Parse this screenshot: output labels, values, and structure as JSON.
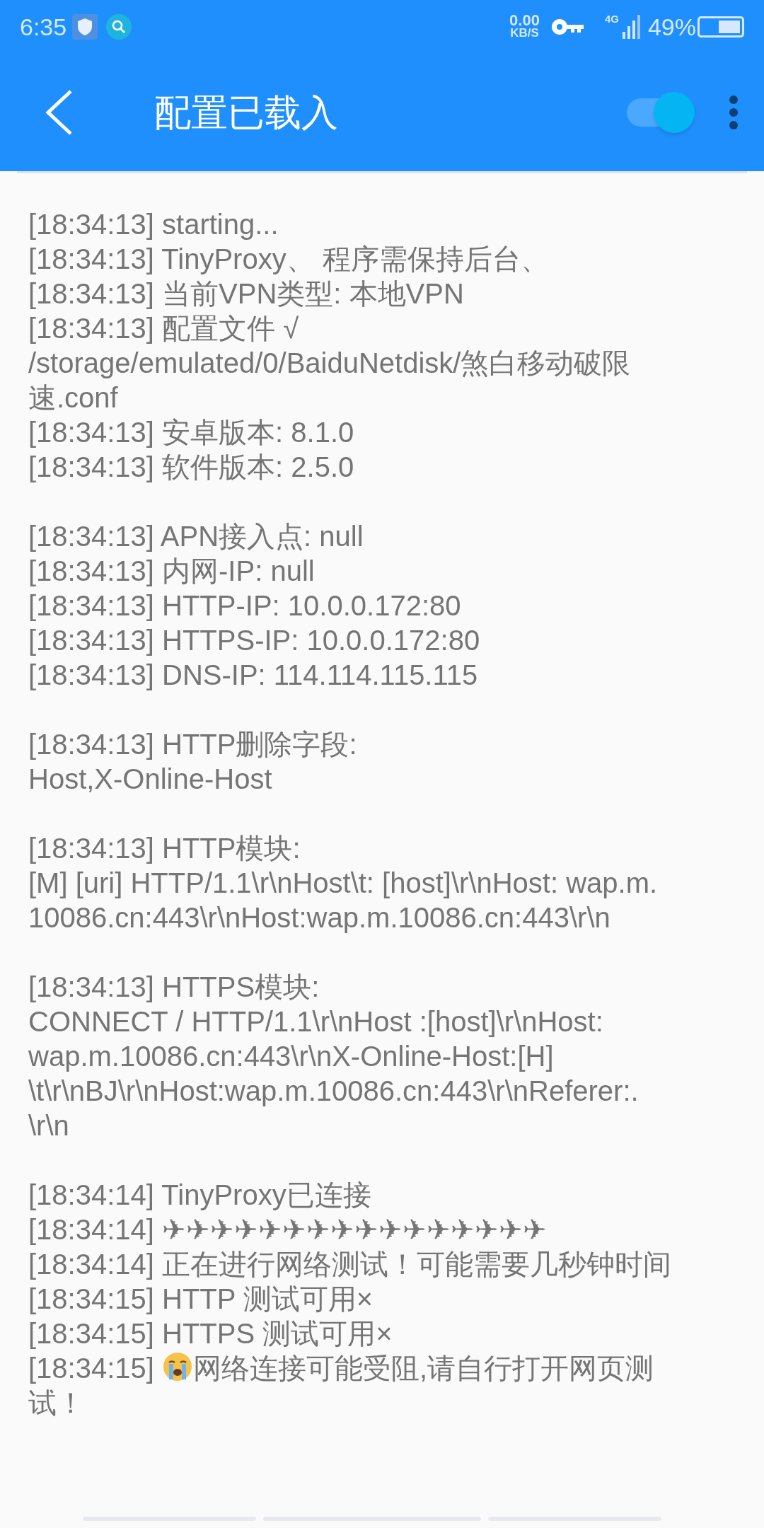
{
  "status_bar": {
    "time": "6:35",
    "net_speed": "0.00",
    "net_unit": "KB/S",
    "network": "4G",
    "battery": "49%"
  },
  "app_bar": {
    "title": "配置已载入",
    "toggle_on": true
  },
  "log_blocks": [
    [
      {
        "text": "[18:34:13] starting..."
      },
      {
        "text": "[18:34:13] TinyProxy、 程序需保持后台、"
      },
      {
        "text": "[18:34:13] 当前VPN类型: 本地VPN"
      },
      {
        "text": "[18:34:13] 配置文件 √"
      },
      {
        "text": "/storage/emulated/0/BaiduNetdisk/煞白移动破限"
      },
      {
        "text": "速.conf"
      },
      {
        "text": "[18:34:13] 安卓版本: 8.1.0"
      },
      {
        "text": "[18:34:13] 软件版本: 2.5.0"
      }
    ],
    [
      {
        "text": "[18:34:13] APN接入点: null"
      },
      {
        "text": "[18:34:13] 内网-IP: null"
      },
      {
        "text": "[18:34:13] HTTP-IP: 10.0.0.172:80"
      },
      {
        "text": "[18:34:13] HTTPS-IP: 10.0.0.172:80"
      },
      {
        "text": "[18:34:13] DNS-IP: 114.114.115.115"
      }
    ],
    [
      {
        "text": "[18:34:13] HTTP删除字段:"
      },
      {
        "text": "Host,X-Online-Host"
      }
    ],
    [
      {
        "text": "[18:34:13] HTTP模块:"
      },
      {
        "text": "[M] [uri] HTTP/1.1\\r\\nHost\\t: [host]\\r\\nHost: wap.m."
      },
      {
        "text": "10086.cn:443\\r\\nHost:wap.m.10086.cn:443\\r\\n"
      }
    ],
    [
      {
        "text": "[18:34:13] HTTPS模块:"
      },
      {
        "text": "CONNECT / HTTP/1.1\\r\\nHost :[host]\\r\\nHost:"
      },
      {
        "text": "wap.m.10086.cn:443\\r\\nX-Online-Host:[H]"
      },
      {
        "text": "\\t\\r\\nBJ\\r\\nHost:wap.m.10086.cn:443\\r\\nReferer:."
      },
      {
        "text": "\\r\\n"
      }
    ],
    [
      {
        "text": "[18:34:14] TinyProxy已连接"
      },
      {
        "text": "[18:34:14] ✈✈✈✈✈✈✈✈✈✈✈✈✈✈✈✈"
      },
      {
        "text": "[18:34:14] 正在进行网络测试！可能需要几秒钟时间"
      },
      {
        "text": "[18:34:15] HTTP 测试可用×"
      },
      {
        "text": "[18:34:15] HTTPS 测试可用×"
      },
      {
        "kind": "emoji",
        "text": "[18:34:15] ",
        "after": "网络连接可能受阻,请自行打开网页测"
      },
      {
        "text": "试！"
      }
    ]
  ]
}
